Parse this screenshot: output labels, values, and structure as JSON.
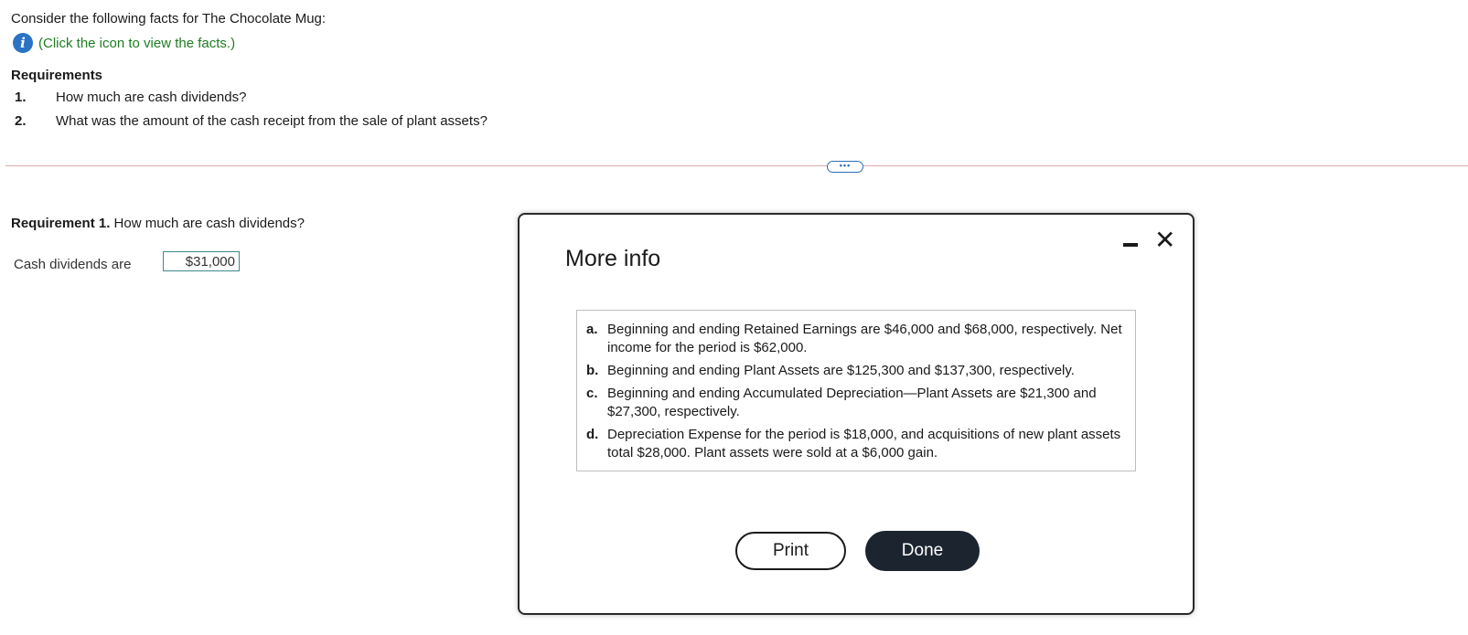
{
  "intro": {
    "text": "Consider the following facts for The Chocolate Mug:",
    "info_icon": "info-icon",
    "info_icon_glyph": "i",
    "info_link": "(Click the icon to view the facts.)"
  },
  "requirements": {
    "heading": "Requirements",
    "items": [
      {
        "num": "1.",
        "text": "How much are cash dividends?"
      },
      {
        "num": "2.",
        "text": "What was the amount of the cash receipt from the sale of plant assets?"
      }
    ]
  },
  "divider": {
    "dots": "•••"
  },
  "requirement1": {
    "label": "Requirement 1.",
    "question": "How much are cash dividends?",
    "answer_label": "Cash dividends are",
    "answer_value": "$31,000"
  },
  "dialog": {
    "title": "More info",
    "minimize_icon": "minimize-icon",
    "close_icon": "close-icon",
    "close_glyph": "✕",
    "facts": [
      {
        "letter": "a.",
        "text": "Beginning and ending Retained Earnings are $46,000 and $68,000, respectively. Net income for the period is $62,000."
      },
      {
        "letter": "b.",
        "text": "Beginning and ending Plant Assets are $125,300 and $137,300, respectively."
      },
      {
        "letter": "c.",
        "text": "Beginning and ending Accumulated Depreciation—Plant Assets are $21,300 and $27,300, respectively."
      },
      {
        "letter": "d.",
        "text": "Depreciation Expense for the period is $18,000, and acquisitions of new plant assets total $28,000. Plant assets were sold at a $6,000 gain."
      }
    ],
    "print_label": "Print",
    "done_label": "Done"
  },
  "colors": {
    "link_green": "#1e7d22",
    "info_blue": "#2b73c4",
    "done_bg": "#1c2430",
    "divider": "#d9a9ad"
  }
}
